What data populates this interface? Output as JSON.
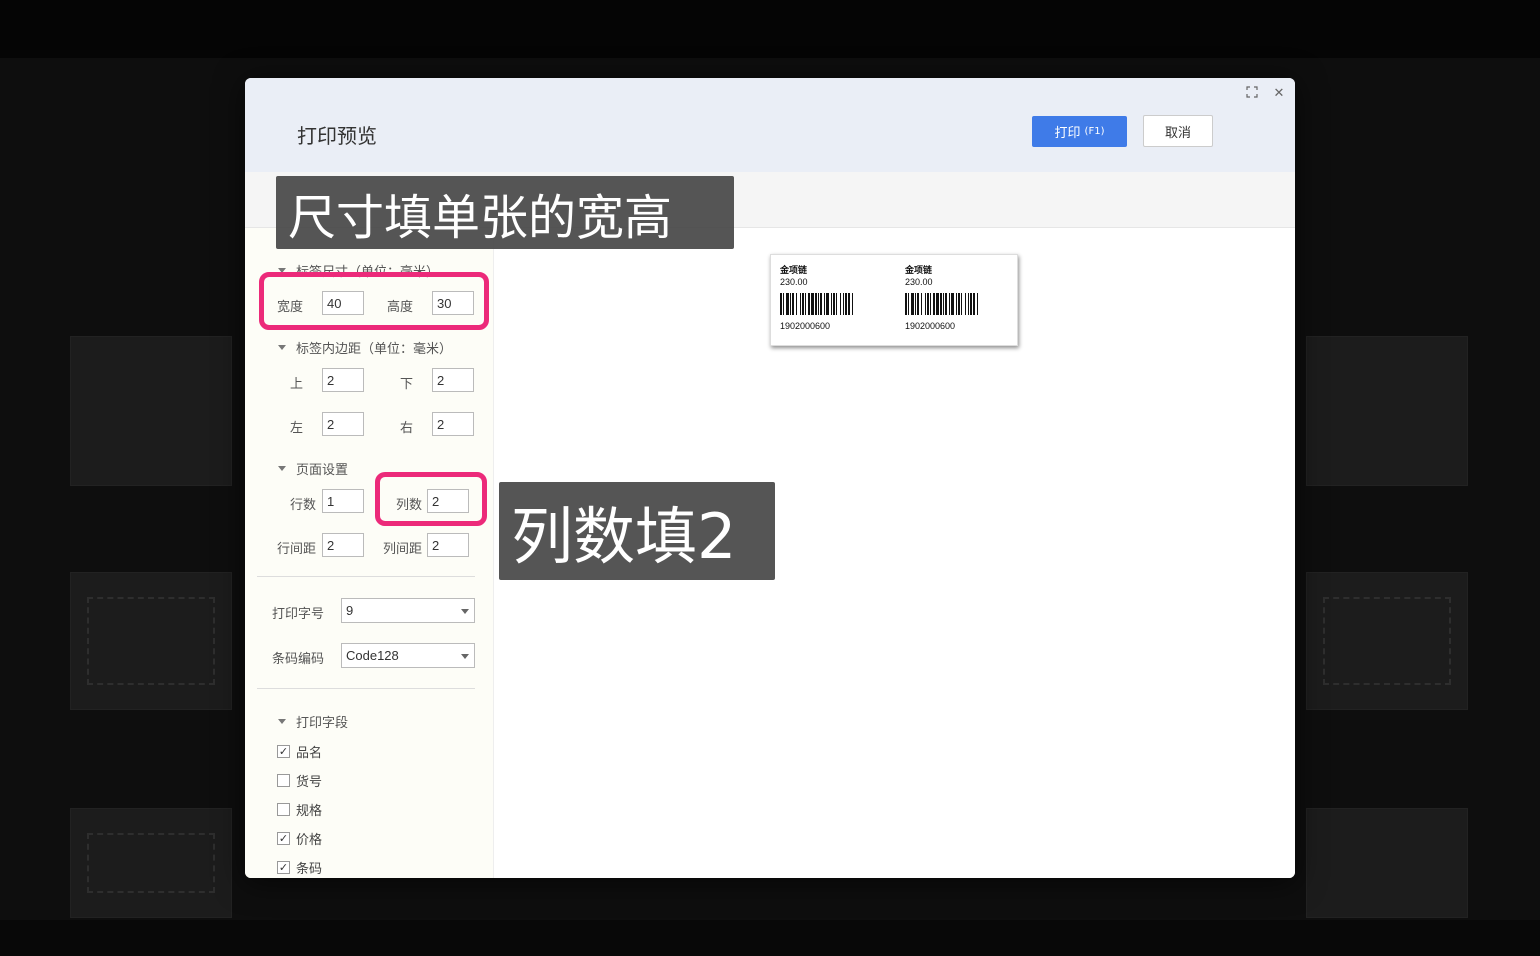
{
  "dialog": {
    "title": "打印预览",
    "print_button": "打印",
    "print_shortcut": "(F1)",
    "cancel_button": "取消"
  },
  "settings": {
    "label_size": {
      "heading": "标签尺寸（单位：毫米）",
      "width_label": "宽度",
      "width_value": "40",
      "height_label": "高度",
      "height_value": "30"
    },
    "label_padding": {
      "heading": "标签内边距（单位：毫米）",
      "top_label": "上",
      "top_value": "2",
      "bottom_label": "下",
      "bottom_value": "2",
      "left_label": "左",
      "left_value": "2",
      "right_label": "右",
      "right_value": "2"
    },
    "page_setup": {
      "heading": "页面设置",
      "rows_label": "行数",
      "rows_value": "1",
      "cols_label": "列数",
      "cols_value": "2",
      "row_gap_label": "行间距",
      "row_gap_value": "2",
      "col_gap_label": "列间距",
      "col_gap_value": "2"
    },
    "font_size_label": "打印字号",
    "font_size_value": "9",
    "barcode_label": "条码编码",
    "barcode_value": "Code128",
    "fields": {
      "heading": "打印字段",
      "items": [
        {
          "label": "品名",
          "checked": true
        },
        {
          "label": "货号",
          "checked": false
        },
        {
          "label": "规格",
          "checked": false
        },
        {
          "label": "价格",
          "checked": true
        },
        {
          "label": "条码",
          "checked": true
        }
      ]
    }
  },
  "preview": {
    "labels": [
      {
        "name": "金项链",
        "price": "230.00",
        "code": "1902000600"
      },
      {
        "name": "金项链",
        "price": "230.00",
        "code": "1902000600"
      }
    ]
  },
  "annotations": {
    "size_note": "尺寸填单张的宽高",
    "cols_note": "列数填2"
  },
  "colors": {
    "primary": "#3f7be8",
    "highlight": "#ec2a7a",
    "header_bg": "#eaeef6",
    "panel_bg": "#fdfdf7"
  }
}
